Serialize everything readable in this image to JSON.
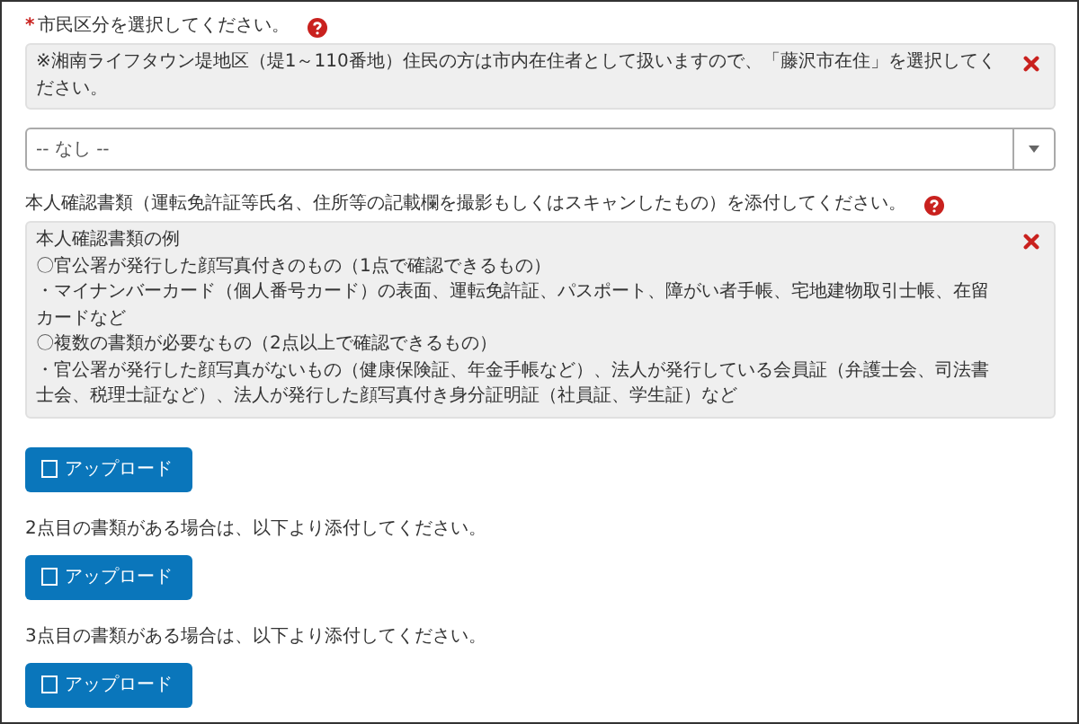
{
  "items": [
    {
      "kind": "label",
      "required_mark": "*",
      "text": "市民区分を選択してください。",
      "help": true
    },
    {
      "kind": "note",
      "lines": [
        "※湘南ライフタウン堤地区（堤1～110番地）住民の方は市内在住者として扱いますので、「藤沢市在住」を選択してください。"
      ]
    },
    {
      "kind": "select",
      "value": "-- なし --"
    },
    {
      "kind": "label",
      "text": "本人確認書類（運転免許証等氏名、住所等の記載欄を撮影もしくはスキャンしたもの）を添付してください。",
      "help": true
    },
    {
      "kind": "note",
      "lines": [
        "本人確認書類の例",
        "〇官公署が発行した顔写真付きのもの（1点で確認できるもの）",
        "・マイナンバーカード（個人番号カード）の表面、運転免許証、パスポート、障がい者手帳、宅地建物取引士帳、在留カードなど",
        "〇複数の書類が必要なもの（2点以上で確認できるもの）",
        "・官公署が発行した顔写真がないもの（健康保険証、年金手帳など）、法人が発行している会員証（弁護士会、司法書士会、税理士証など）、法人が発行した顔写真付き身分証明証（社員証、学生証）など"
      ]
    },
    {
      "kind": "upload",
      "label": "アップロード"
    },
    {
      "kind": "text",
      "text": "2点目の書類がある場合は、以下より添付してください。"
    },
    {
      "kind": "upload",
      "label": "アップロード"
    },
    {
      "kind": "text",
      "text": "3点目の書類がある場合は、以下より添付してください。"
    },
    {
      "kind": "upload",
      "label": "アップロード"
    }
  ]
}
